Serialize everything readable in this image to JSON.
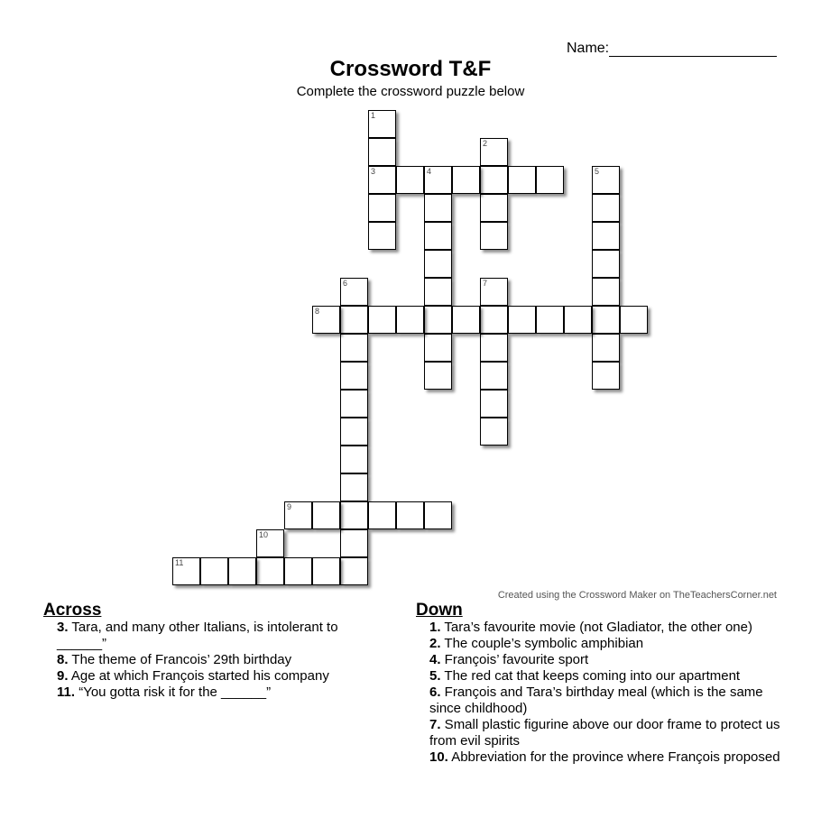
{
  "header": {
    "name_label": "Name:",
    "title": "Crossword T&F",
    "subtitle": "Complete the crossword puzzle below"
  },
  "credit": "Created using the Crossword Maker on TheTeachersCorner.net",
  "grid": {
    "words": [
      {
        "number": 1,
        "row": 0,
        "col": 7,
        "direction": "down",
        "length": 5
      },
      {
        "number": 2,
        "row": 1,
        "col": 11,
        "direction": "down",
        "length": 4
      },
      {
        "number": 3,
        "row": 2,
        "col": 7,
        "direction": "across",
        "length": 7
      },
      {
        "number": 4,
        "row": 2,
        "col": 9,
        "direction": "down",
        "length": 8
      },
      {
        "number": 5,
        "row": 2,
        "col": 15,
        "direction": "down",
        "length": 8
      },
      {
        "number": 6,
        "row": 6,
        "col": 6,
        "direction": "down",
        "length": 11
      },
      {
        "number": 7,
        "row": 6,
        "col": 11,
        "direction": "down",
        "length": 6
      },
      {
        "number": 8,
        "row": 7,
        "col": 5,
        "direction": "across",
        "length": 12
      },
      {
        "number": 9,
        "row": 14,
        "col": 4,
        "direction": "across",
        "length": 6
      },
      {
        "number": 10,
        "row": 15,
        "col": 3,
        "direction": "down",
        "length": 2
      },
      {
        "number": 11,
        "row": 16,
        "col": 0,
        "direction": "across",
        "length": 7
      }
    ]
  },
  "across": {
    "heading": "Across",
    "clues": [
      {
        "number": "3.",
        "text": "Tara, and many other Italians, is intolerant to ______”"
      },
      {
        "number": "8.",
        "text": "The theme of Francois’ 29th birthday"
      },
      {
        "number": "9.",
        "text": "Age at which François started his company"
      },
      {
        "number": "11.",
        "text": "“You gotta risk it for the ______”"
      }
    ]
  },
  "down": {
    "heading": "Down",
    "clues": [
      {
        "number": "1.",
        "text": "Tara’s favourite movie (not Gladiator, the other one)"
      },
      {
        "number": "2.",
        "text": "The couple’s symbolic amphibian"
      },
      {
        "number": "4.",
        "text": "François’ favourite sport"
      },
      {
        "number": "5.",
        "text": "The red cat that keeps coming into our apartment"
      },
      {
        "number": "6.",
        "text": "François and Tara’s birthday meal (which is the same since childhood)"
      },
      {
        "number": "7.",
        "text": "Small plastic figurine above our door frame to protect us from evil spirits"
      },
      {
        "number": "10.",
        "text": "Abbreviation for the province where François proposed"
      }
    ]
  }
}
